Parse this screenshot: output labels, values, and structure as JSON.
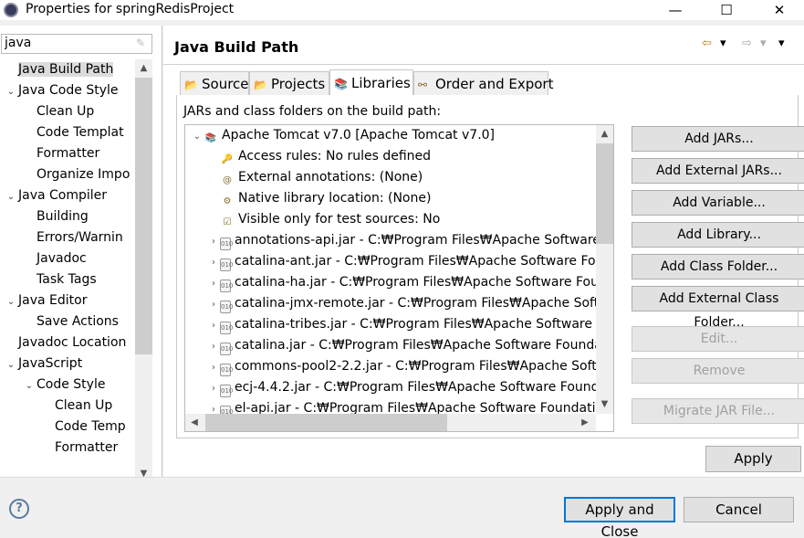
{
  "window": {
    "title": "Properties for springRedisProject",
    "minimize": "—",
    "maximize": "☐",
    "close": "✕"
  },
  "filter": {
    "value": "java"
  },
  "nav_tree": [
    {
      "label": "Java Build Path",
      "level": 0,
      "twisty": "",
      "selected": true
    },
    {
      "label": "Java Code Style",
      "level": 0,
      "twisty": "⌄"
    },
    {
      "label": "Clean Up",
      "level": 1,
      "twisty": ""
    },
    {
      "label": "Code Templat",
      "level": 1,
      "twisty": ""
    },
    {
      "label": "Formatter",
      "level": 1,
      "twisty": ""
    },
    {
      "label": "Organize Impo",
      "level": 1,
      "twisty": ""
    },
    {
      "label": "Java Compiler",
      "level": 0,
      "twisty": "⌄"
    },
    {
      "label": "Building",
      "level": 1,
      "twisty": ""
    },
    {
      "label": "Errors/Warnin",
      "level": 1,
      "twisty": ""
    },
    {
      "label": "Javadoc",
      "level": 1,
      "twisty": ""
    },
    {
      "label": "Task Tags",
      "level": 1,
      "twisty": ""
    },
    {
      "label": "Java Editor",
      "level": 0,
      "twisty": "⌄"
    },
    {
      "label": "Save Actions",
      "level": 1,
      "twisty": ""
    },
    {
      "label": "Javadoc Location",
      "level": 0,
      "twisty": ""
    },
    {
      "label": "JavaScript",
      "level": 0,
      "twisty": "⌄"
    },
    {
      "label": "Code Style",
      "level": 1,
      "twisty": "⌄"
    },
    {
      "label": "Clean Up",
      "level": 2,
      "twisty": ""
    },
    {
      "label": "Code Temp",
      "level": 2,
      "twisty": ""
    },
    {
      "label": "Formatter",
      "level": 2,
      "twisty": ""
    }
  ],
  "page": {
    "title": "Java Build Path",
    "nav": {
      "back": "⇦",
      "back_menu": "▾",
      "forward": "⇨",
      "forward_menu": "▾",
      "view_menu": "▾"
    }
  },
  "tabs": [
    {
      "label": "Source",
      "icon": "📂",
      "active": false
    },
    {
      "label": "Projects",
      "icon": "📂",
      "active": false
    },
    {
      "label": "Libraries",
      "icon": "📚",
      "active": true
    },
    {
      "label": "Order and Export",
      "icon": "⚯",
      "active": false
    }
  ],
  "libraries": {
    "description": "JARs and class folders on the build path:",
    "rows": [
      {
        "text": "Apache Tomcat v7.0 [Apache Tomcat v7.0]",
        "level": 0,
        "twisty": "⌄",
        "icon": "library-icon"
      },
      {
        "text": "Access rules: No rules defined",
        "level": 1,
        "twisty": "",
        "icon": "access-rules-icon"
      },
      {
        "text": "External annotations: (None)",
        "level": 1,
        "twisty": "",
        "icon": "annotations-icon"
      },
      {
        "text": "Native library location: (None)",
        "level": 1,
        "twisty": "",
        "icon": "native-library-icon"
      },
      {
        "text": "Visible only for test sources: No",
        "level": 1,
        "twisty": "",
        "icon": "test-sources-icon"
      },
      {
        "text": "annotations-api.jar - C:₩Program Files₩Apache Software",
        "level": 1,
        "twisty": "›",
        "icon": "jar-icon"
      },
      {
        "text": "catalina-ant.jar - C:₩Program Files₩Apache Software Fou",
        "level": 1,
        "twisty": "›",
        "icon": "jar-icon"
      },
      {
        "text": "catalina-ha.jar - C:₩Program Files₩Apache Software Fou",
        "level": 1,
        "twisty": "›",
        "icon": "jar-icon"
      },
      {
        "text": "catalina-jmx-remote.jar - C:₩Program Files₩Apache Soft",
        "level": 1,
        "twisty": "›",
        "icon": "jar-icon"
      },
      {
        "text": "catalina-tribes.jar - C:₩Program Files₩Apache Software F",
        "level": 1,
        "twisty": "›",
        "icon": "jar-icon"
      },
      {
        "text": "catalina.jar - C:₩Program Files₩Apache Software Founda",
        "level": 1,
        "twisty": "›",
        "icon": "jar-icon"
      },
      {
        "text": "commons-pool2-2.2.jar - C:₩Program Files₩Apache Soft",
        "level": 1,
        "twisty": "›",
        "icon": "jar-icon"
      },
      {
        "text": "ecj-4.4.2.jar - C:₩Program Files₩Apache Software Found",
        "level": 1,
        "twisty": "›",
        "icon": "jar-icon"
      },
      {
        "text": "el-api.jar - C:₩Program Files₩Apache Software Foundati",
        "level": 1,
        "twisty": "›",
        "icon": "jar-icon"
      }
    ]
  },
  "buttons": {
    "add_jars": "Add JARs...",
    "add_external_jars": "Add External JARs...",
    "add_variable": "Add Variable...",
    "add_library": "Add Library...",
    "add_class_folder": "Add Class Folder...",
    "add_external_class_folder": "Add External Class Folder...",
    "edit": "Edit...",
    "remove": "Remove",
    "migrate_jar": "Migrate JAR File...",
    "apply": "Apply",
    "apply_and_close": "Apply and Close",
    "cancel": "Cancel"
  },
  "help": "?"
}
